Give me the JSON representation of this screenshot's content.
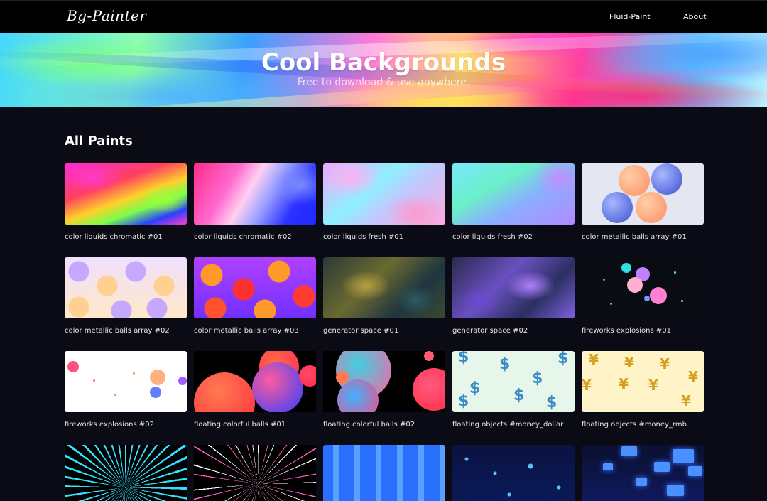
{
  "nav": {
    "logo": "Bg-Painter",
    "links": [
      "Fluid-Paint",
      "About"
    ]
  },
  "hero": {
    "title": "Cool Backgrounds",
    "subtitle": "Free to download & use anywhere."
  },
  "section": {
    "title": "All Paints"
  },
  "paints": [
    "color liquids chromatic #01",
    "color liquids chromatic #02",
    "color liquids fresh #01",
    "color liquids fresh #02",
    "color metallic balls array #01",
    "color metallic balls array #02",
    "color metallic balls array #03",
    "generator space #01",
    "generator space #02",
    "fireworks explosions #01",
    "fireworks explosions #02",
    "floating colorful balls #01",
    "floating colorful balls #02",
    "floating objects #money_dollar",
    "floating objects #money_rmb"
  ],
  "icons": {
    "dollar": "$",
    "rmb": "¥"
  }
}
